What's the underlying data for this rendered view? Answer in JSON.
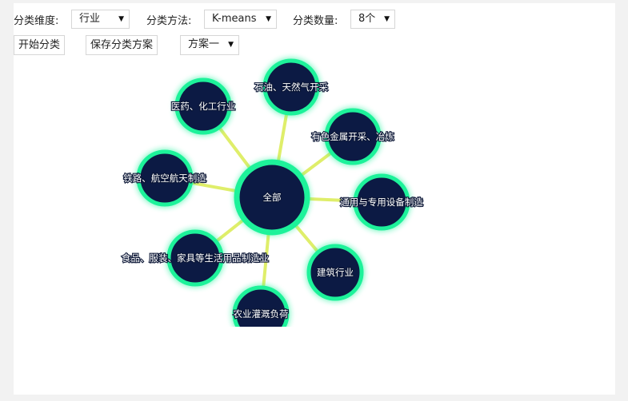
{
  "toolbar": {
    "dimension": {
      "label": "分类维度:",
      "value": "行业"
    },
    "method": {
      "label": "分类方法:",
      "value": "K-means"
    },
    "count": {
      "label": "分类数量:",
      "value": "8个"
    },
    "start_button": "开始分类",
    "save_button": "保存分类方案",
    "scheme": {
      "value": "方案一"
    }
  },
  "graph": {
    "center": "全部",
    "nodes": [
      "石油、天然气开采",
      "医药、化工行业",
      "有色金属开采、冶炼",
      "铁路、航空航天制造",
      "通用与专用设备制造",
      "食品、服装、家具等生活用品制造业",
      "建筑行业",
      "农业灌溉负荷"
    ],
    "colors": {
      "node_fill": "#0c1a44",
      "node_ring": "#1df29a",
      "edge": "#dfee6a"
    }
  }
}
